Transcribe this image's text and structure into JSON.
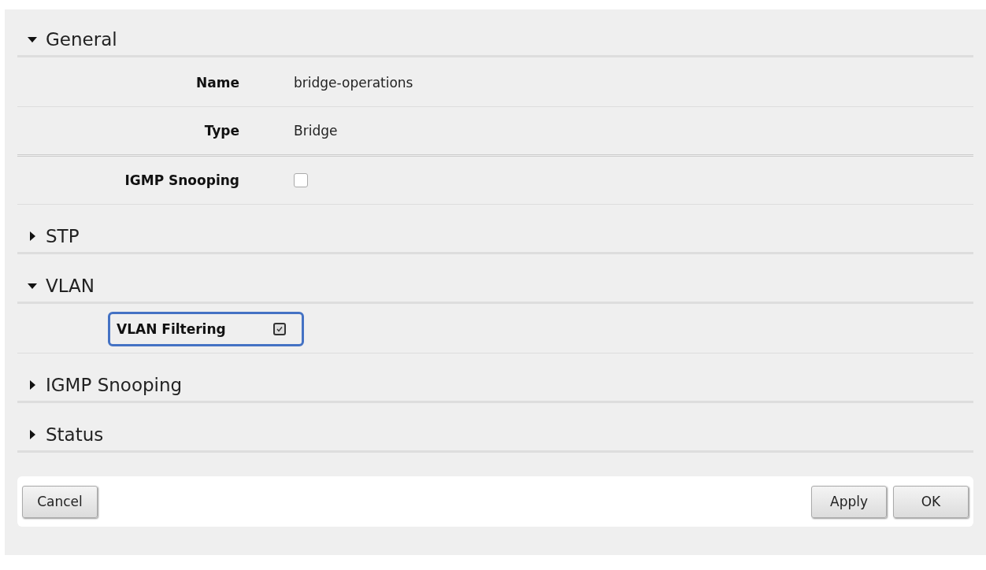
{
  "sections": [
    {
      "title": "General",
      "expanded": true,
      "fields": [
        {
          "kind": "text",
          "label": "Name",
          "value": "bridge-operations",
          "highlighted": false
        },
        {
          "kind": "text",
          "label": "Type",
          "value": "Bridge",
          "highlighted": false,
          "divider_after": true
        },
        {
          "kind": "checkbox",
          "label": "IGMP Snooping",
          "checked": false,
          "highlighted": false
        }
      ]
    },
    {
      "title": "STP",
      "expanded": false
    },
    {
      "title": "VLAN",
      "expanded": true,
      "fields": [
        {
          "kind": "checkbox",
          "label": "VLAN Filtering",
          "checked": true,
          "highlighted": true
        }
      ]
    },
    {
      "title": "IGMP Snooping",
      "expanded": false
    },
    {
      "title": "Status",
      "expanded": false
    }
  ],
  "buttons_left": [
    "Cancel"
  ],
  "buttons_right": [
    "Apply",
    "OK"
  ]
}
